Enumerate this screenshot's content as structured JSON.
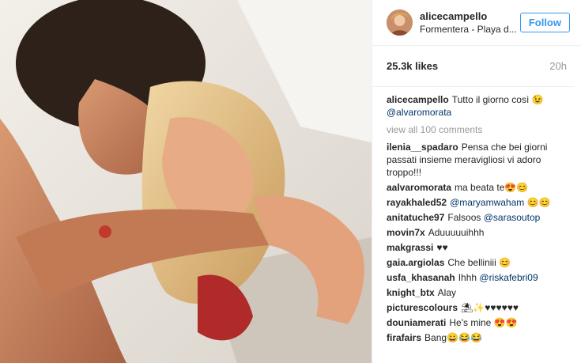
{
  "post": {
    "username": "alicecampello",
    "location": "Formentera - Playa d...",
    "follow_label": "Follow",
    "likes": "25.3k likes",
    "time": "20h"
  },
  "caption": {
    "user": "alicecampello",
    "text": "Tutto il giorno così 😉",
    "mention": "@alvaromorata"
  },
  "view_all": "view all 100 comments",
  "comments": [
    {
      "user": "ilenia__spadaro",
      "text": "Pensa che bei giorni passati insieme meravigliosi vi adoro troppo!!!",
      "mention": ""
    },
    {
      "user": "aalvaromorata",
      "text": "ma beata te😍😊",
      "mention": ""
    },
    {
      "user": "rayakhaled52",
      "text": "",
      "mention": "@maryamwaham",
      "after": " 😊😊"
    },
    {
      "user": "anitatuche97",
      "text": "Falsoos",
      "mention": "@sarasoutop"
    },
    {
      "user": "movin7x",
      "text": "Aduuuuuihhh",
      "mention": ""
    },
    {
      "user": "makgrassi",
      "text": "♥♥",
      "mention": ""
    },
    {
      "user": "gaia.argiolas",
      "text": "Che belliniii 😊",
      "mention": ""
    },
    {
      "user": "usfa_khasanah",
      "text": "Ihhh",
      "mention": "@riskafebri09"
    },
    {
      "user": "knight_btx",
      "text": "Alay",
      "mention": ""
    },
    {
      "user": "picturescolours",
      "text": "⛱✨♥♥♥♥♥♥",
      "mention": ""
    },
    {
      "user": "douniamerati",
      "text": "He's mine 😍😍",
      "mention": ""
    },
    {
      "user": "firafairs",
      "text": "Bang😀😂😂",
      "mention": ""
    }
  ],
  "colors": {
    "accent": "#3897f0",
    "mention": "#003569",
    "muted": "#999999",
    "text": "#262626"
  },
  "icons": {
    "avatar": "profile-avatar"
  }
}
